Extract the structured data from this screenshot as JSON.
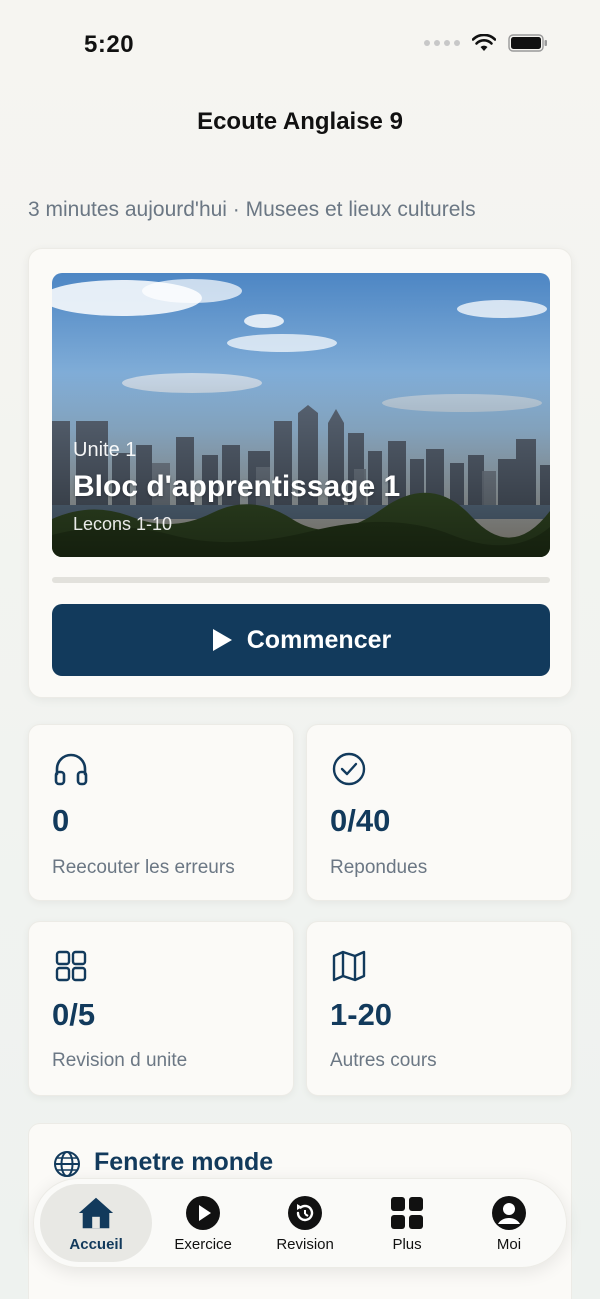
{
  "status_bar": {
    "time": "5:20"
  },
  "app": {
    "title": "Ecoute Anglaise 9"
  },
  "subtitle": "3 minutes aujourd'hui · Musees et lieux culturels",
  "hero": {
    "unit": "Unite 1",
    "title": "Bloc d'apprentissage 1",
    "lessons": "Lecons 1-10",
    "progress": 0,
    "start_label": "Commencer"
  },
  "stats": [
    {
      "icon": "headphones-icon",
      "value": "0",
      "label": "Reecouter les erreurs"
    },
    {
      "icon": "check-circle-icon",
      "value": "0/40",
      "label": "Repondues"
    },
    {
      "icon": "grid-icon",
      "value": "0/5",
      "label": "Revision d unite"
    },
    {
      "icon": "map-icon",
      "value": "1-20",
      "label": "Autres cours"
    }
  ],
  "world": {
    "icon": "globe-icon",
    "title": "Fenetre monde"
  },
  "tabs": [
    {
      "icon": "home-icon",
      "label": "Accueil",
      "active": true
    },
    {
      "icon": "play-circle-icon",
      "label": "Exercice"
    },
    {
      "icon": "revision-icon",
      "label": "Revision"
    },
    {
      "icon": "apps-icon",
      "label": "Plus"
    },
    {
      "icon": "profile-icon",
      "label": "Moi"
    }
  ],
  "colors": {
    "accent": "#123a5c",
    "muted_text": "#6b7784",
    "card_bg": "#fbfaf7"
  }
}
